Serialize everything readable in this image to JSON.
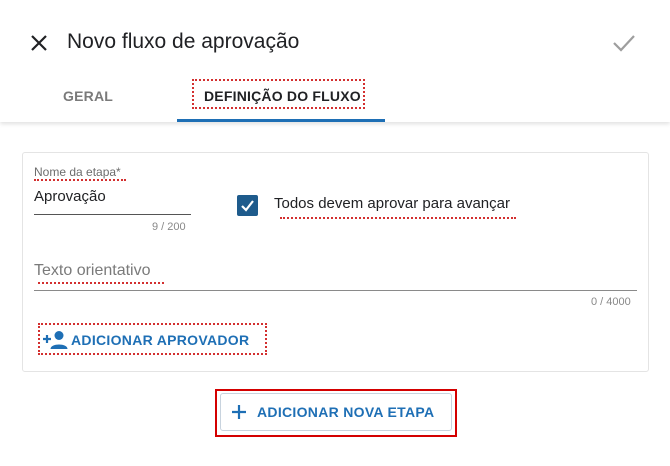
{
  "header": {
    "title": "Novo fluxo de aprovação",
    "close_icon": "close-icon",
    "confirm_icon": "check-icon"
  },
  "tabs": [
    {
      "label": "GERAL",
      "active": false
    },
    {
      "label": "DEFINIÇÃO DO FLUXO",
      "active": true
    }
  ],
  "stage": {
    "name_label": "Nome da etapa*",
    "name_value": "Aprovação",
    "name_counter": "9 / 200",
    "all_approve_label": "Todos devem aprovar para avançar",
    "all_approve_checked": true,
    "guide_placeholder": "Texto orientativo",
    "guide_counter": "0 / 4000",
    "add_approver_label": "ADICIONAR APROVADOR",
    "add_approver_icon": "person-add-icon"
  },
  "actions": {
    "add_stage_label": "ADICIONAR NOVA ETAPA",
    "add_stage_icon": "plus-icon"
  },
  "colors": {
    "accent": "#1e6fb5",
    "checkbox": "#1e5b8c",
    "highlight": "#d32f2f"
  }
}
